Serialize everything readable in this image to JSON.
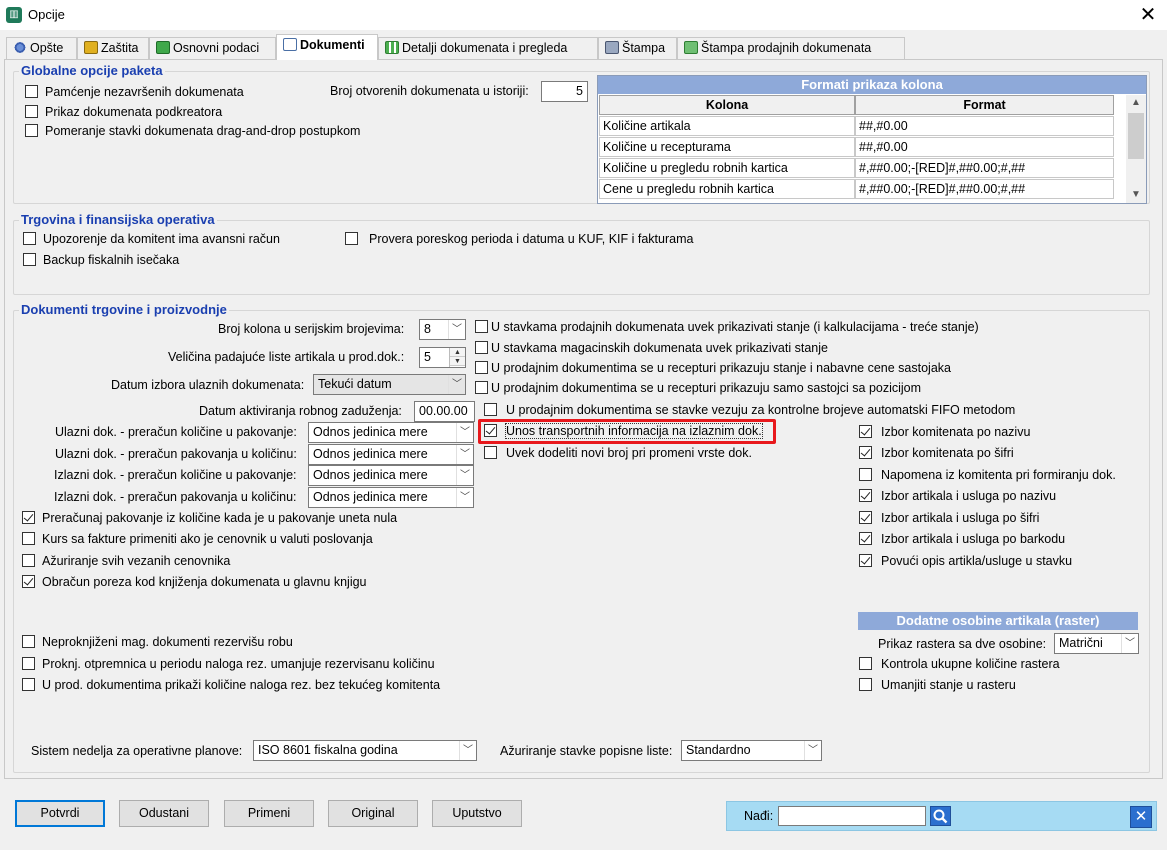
{
  "window": {
    "title": "Opcije",
    "close_glyph": "✕"
  },
  "tabs": [
    {
      "label": "Opšte",
      "icon": "gear-icon"
    },
    {
      "label": "Zaštita",
      "icon": "lock-icon"
    },
    {
      "label": "Osnovni podaci",
      "icon": "database-icon"
    },
    {
      "label": "Dokumenti",
      "icon": "document-icon"
    },
    {
      "label": "Detalji dokumenata i pregleda",
      "icon": "grid-icon"
    },
    {
      "label": "Štampa",
      "icon": "printer-icon"
    },
    {
      "label": "Štampa prodajnih dokumenata",
      "icon": "printer-green-icon"
    }
  ],
  "global": {
    "title": "Globalne opcije paketa",
    "cb_unsaved": "Pamćenje nezavršenih dokumenata",
    "cb_subcreator": "Prikaz dokumenata podkreatora",
    "cb_dragdrop": "Pomeranje stavki dokumenata drag-and-drop postupkom",
    "history_label": "Broj otvorenih dokumenata u istoriji:",
    "history_value": "5"
  },
  "formats": {
    "title": "Formati prikaza kolona",
    "col_kolona": "Kolona",
    "col_format": "Format",
    "rows": [
      {
        "kolona": "Količine artikala",
        "format": "##,#0.00"
      },
      {
        "kolona": "Količine u recepturama",
        "format": "##,#0.00"
      },
      {
        "kolona": "Količine u pregledu robnih kartica",
        "format": "#,##0.00;-[RED]#,##0.00;#,##"
      },
      {
        "kolona": "Cene u pregledu robnih kartica",
        "format": "#,##0.00;-[RED]#,##0.00;#,##"
      }
    ]
  },
  "trade": {
    "title": "Trgovina i finansijska operativa",
    "cb_advance": "Upozorenje da komitent ima avansni račun",
    "cb_backup": "Backup fiskalnih isečaka",
    "cb_tax_period": "Provera poreskog perioda i datuma u KUF, KIF i fakturama"
  },
  "docs": {
    "title": "Dokumenti trgovine i proizvodnje",
    "serial_cols_label": "Broj kolona u serijskim brojevima:",
    "serial_cols_value": "8",
    "dropdown_size_label": "Veličina padajuće liste artikala u prod.dok.:",
    "dropdown_size_value": "5",
    "date_choice_label": "Datum izbora ulaznih dokumenata:",
    "date_choice_value": "Tekući datum",
    "activation_date_label": "Datum aktiviranja robnog zaduženja:",
    "activation_date_value": "00.00.00",
    "in_qty_label": "Ulazni dok. - preračun količine u pakovanje:",
    "in_pack_label": "Ulazni dok. - preračun pakovanja u količinu:",
    "out_qty_label": "Izlazni dok. - preračun količine u pakovanje:",
    "out_pack_label": "Izlazni dok. - preračun pakovanja u količinu:",
    "unit_ratio_value": "Odnos jedinica mere",
    "cb_recalc_pack": "Preračunaj pakovanje iz količine kada je u pakovanje uneta nula",
    "cb_exchange_rate": "Kurs sa fakture primeniti ako je cenovnik u valuti poslovanja",
    "cb_update_pricelists": "Ažuriranje svih vezanih cenovnika",
    "cb_tax_ledger": "Obračun poreza kod knjiženja dokumenata u glavnu knjigu",
    "cb_sales_stock": "U stavkama prodajnih dokumenata uvek prikazivati stanje (i kalkulacijama - treće stanje)",
    "cb_warehouse_stock": "U stavkama magacinskih dokumenata uvek prikazivati stanje",
    "cb_recipe_stock": "U prodajnim dokumentima se u recepturi prikazuju stanje i nabavne cene sastojaka",
    "cb_recipe_positions": "U prodajnim dokumentima se u recepturi prikazuju samo sastojci sa pozicijom",
    "cb_fifo": "U prodajnim dokumentima se stavke vezuju za kontrolne brojeve automatski FIFO metodom",
    "cb_transport": "Unos transportnih informacija na izlaznim dok.",
    "cb_new_number": "Uvek dodeliti novi broj pri promeni vrste dok.",
    "cb_client_name": "Izbor komitenata po nazivu",
    "cb_client_code": "Izbor komitenata po šifri",
    "cb_client_note": "Napomena iz komitenta pri formiranju dok.",
    "cb_item_name": "Izbor artikala i usluga po nazivu",
    "cb_item_code": "Izbor artikala i usluga po šifri",
    "cb_item_barcode": "Izbor artikala i usluga po barkodu",
    "cb_item_desc": "Povući opis artikla/usluge u stavku",
    "cb_unposted": "Neproknjiženi mag. dokumenti rezervišu robu",
    "cb_dispatch": "Proknj. otpremnica u periodu naloga rez. umanjuje rezervisanu količinu",
    "cb_order_qty": "U prod. dokumentima prikaži količine naloga rez. bez tekućeg komitenta",
    "week_system_label": "Sistem nedelja za operativne planove:",
    "week_system_value": "ISO 8601 fiskalna godina",
    "inventory_update_label": "Ažuriranje stavke popisne liste:",
    "inventory_update_value": "Standardno"
  },
  "raster": {
    "title": "Dodatne osobine artikala (raster)",
    "display_label": "Prikaz rastera sa dve osobine:",
    "display_value": "Matrični",
    "cb_total_control": "Kontrola ukupne količine rastera",
    "cb_reduce_stock": "Umanjiti stanje u rasteru"
  },
  "buttons": {
    "confirm": "Potvrdi",
    "cancel": "Odustani",
    "apply": "Primeni",
    "original": "Original",
    "help": "Uputstvo"
  },
  "search": {
    "label": "Nađi:",
    "value": ""
  }
}
